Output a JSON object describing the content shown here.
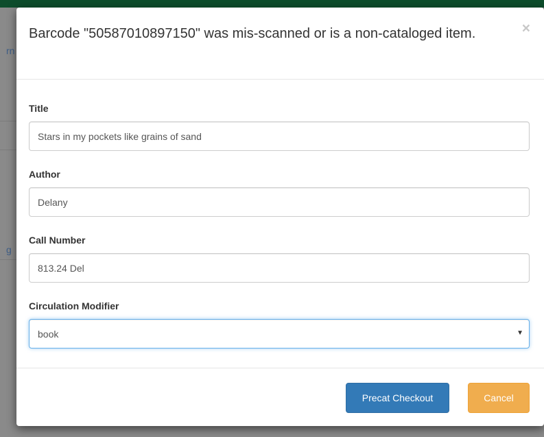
{
  "background": {
    "fragment_top": "rn",
    "fragment_mid": "g"
  },
  "modal": {
    "title": "Barcode \"50587010897150\" was mis-scanned or is a non-cataloged item.",
    "close_glyph": "×"
  },
  "form": {
    "title": {
      "label": "Title",
      "value": "Stars in my pockets like grains of sand"
    },
    "author": {
      "label": "Author",
      "value": "Delany"
    },
    "call_number": {
      "label": "Call Number",
      "value": "813.24 Del"
    },
    "circ_modifier": {
      "label": "Circulation Modifier",
      "value": "book"
    }
  },
  "footer": {
    "checkout_label": "Precat Checkout",
    "cancel_label": "Cancel"
  },
  "colors": {
    "primary": "#337ab7",
    "warning": "#f0ad4e",
    "top_bar": "#0d4d2c"
  },
  "icons": {
    "close": "close-icon",
    "select_caret": "caret-down-icon"
  }
}
